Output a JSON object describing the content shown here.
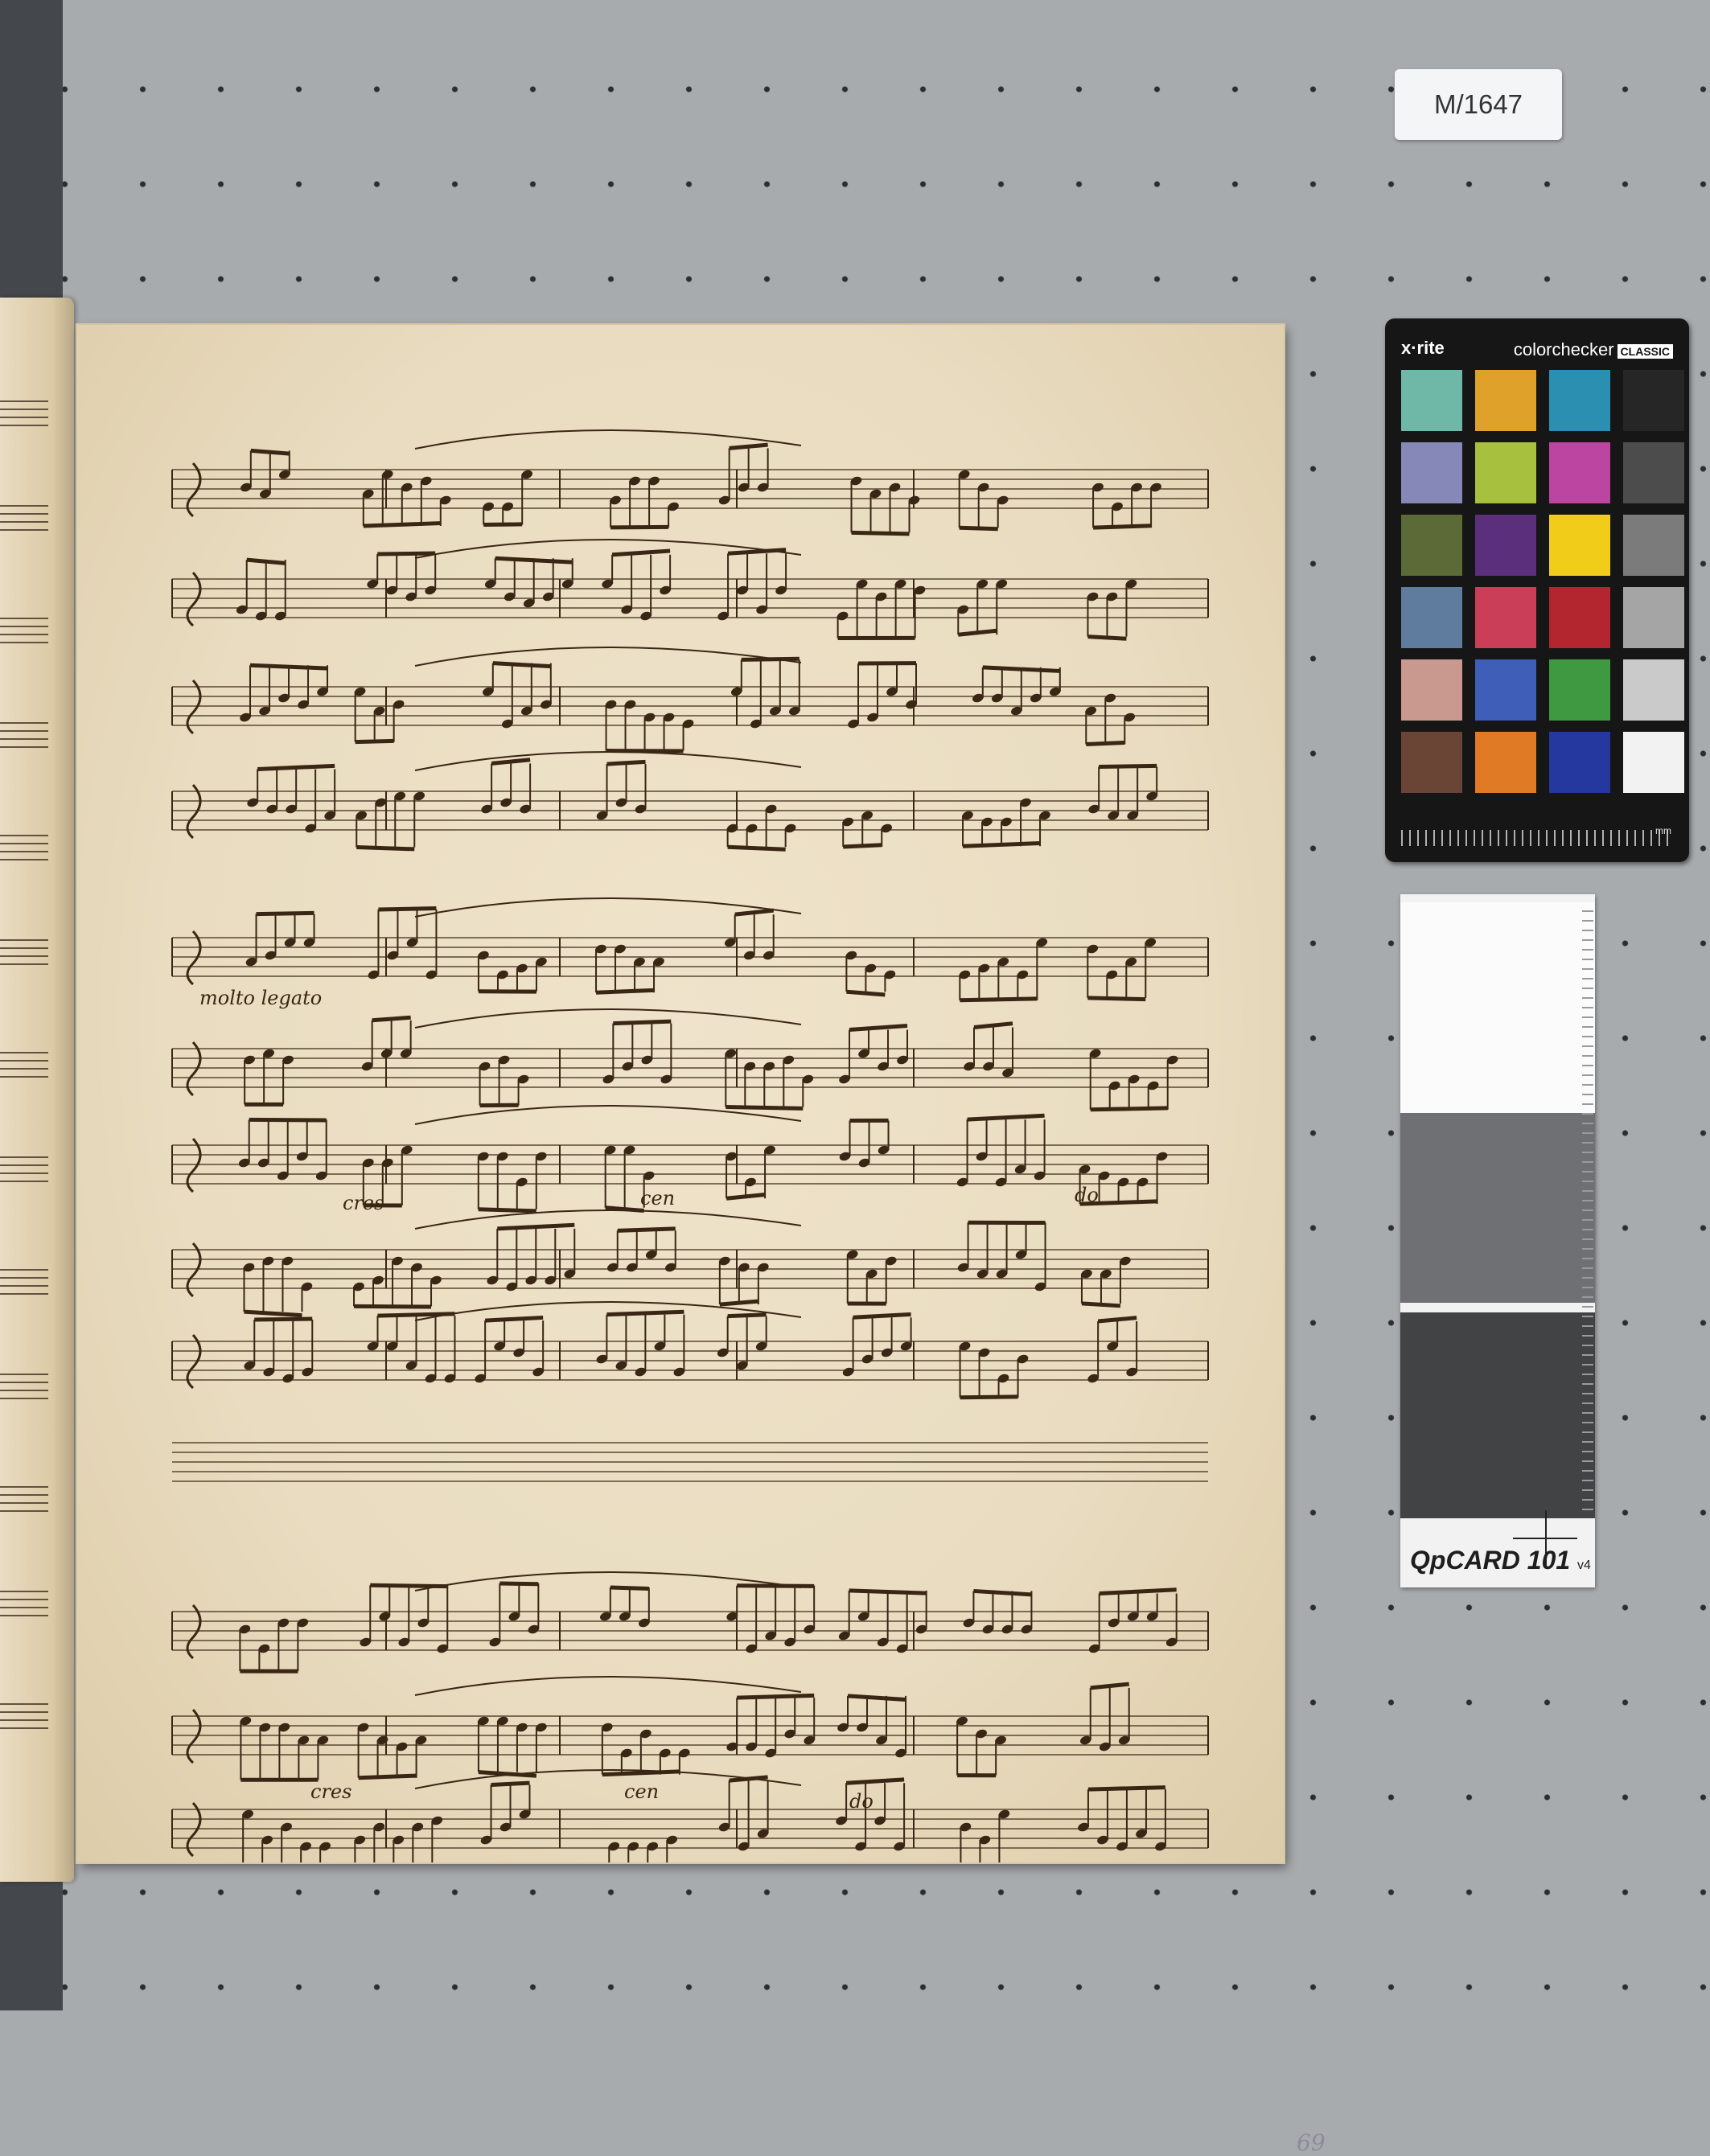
{
  "label_card": {
    "text": "M/1647"
  },
  "manuscript": {
    "directions": [
      "molto legato",
      "cres",
      "cen",
      "do",
      "cres",
      "cen",
      "do"
    ],
    "folio_number": "69"
  },
  "colorchecker": {
    "brand": "x·rite",
    "product": "colorchecker",
    "edition": "CLASSIC",
    "unit": "mm",
    "swatches": [
      "#6fb8a8",
      "#e0a12a",
      "#2a8fb0",
      "#262626",
      "#8688b7",
      "#a7c03d",
      "#bb45a0",
      "#4c4c4c",
      "#5b6a37",
      "#5c2f7c",
      "#f1cc18",
      "#7b7b7b",
      "#5f7b9d",
      "#cb3e58",
      "#b3262f",
      "#a5a5a5",
      "#c99990",
      "#3e5eb8",
      "#3f9940",
      "#cacaca",
      "#6a4536",
      "#e07a25",
      "#2438a0",
      "#f2f2f2"
    ]
  },
  "grey_card": {
    "brand": "QpCARD 101",
    "version": "v4"
  }
}
